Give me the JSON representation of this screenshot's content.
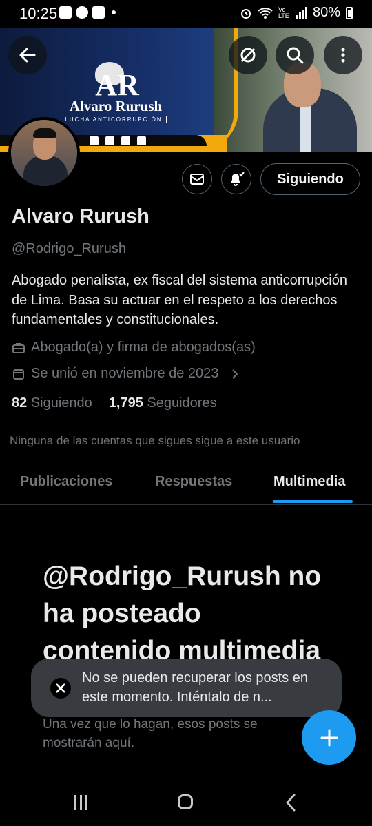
{
  "status_bar": {
    "time": "10:25",
    "battery": "80%",
    "network": "Vo LTE"
  },
  "banner": {
    "logo_initials": "AR",
    "logo_name": "Alvaro Rurush",
    "logo_tagline": "LUCHA ANTICORRUPCIÓN"
  },
  "header_actions": {
    "back_icon": "arrow-left-icon",
    "grok_icon": "grok-icon",
    "search_icon": "search-icon",
    "more_icon": "more-vertical-icon"
  },
  "profile": {
    "name": "Alvaro Rurush",
    "handle": "@Rodrigo_Rurush",
    "bio": "Abogado penalista, ex fiscal del sistema anticorrupción de Lima. Basa su actuar en el respeto a los derechos fundamentales y constitucionales.",
    "category": "Abogado(a) y firma de abogados(as)",
    "joined": "Se unió en noviembre de 2023",
    "following_count": "82",
    "following_label": "Siguiendo",
    "followers_count": "1,795",
    "followers_label": "Seguidores",
    "mutuals_note": "Ninguna de las cuentas que sigues sigue a este usuario"
  },
  "actions": {
    "follow_button": "Siguiendo"
  },
  "tabs": [
    {
      "label": "Publicaciones",
      "active": false
    },
    {
      "label": "Respuestas",
      "active": false
    },
    {
      "label": "Multimedia",
      "active": true
    }
  ],
  "empty_state": {
    "title": "@Rodrigo_Rurush no ha posteado contenido multimedia",
    "subtitle": "Una vez que lo hagan, esos posts se mostrarán aquí."
  },
  "toast": {
    "message": "No se pueden recuperar los posts en este momento. Inténtalo de n..."
  },
  "colors": {
    "accent": "#1d9bf0",
    "background": "#000000",
    "secondary_text": "#71767b",
    "banner_gold": "#f2a90c"
  }
}
